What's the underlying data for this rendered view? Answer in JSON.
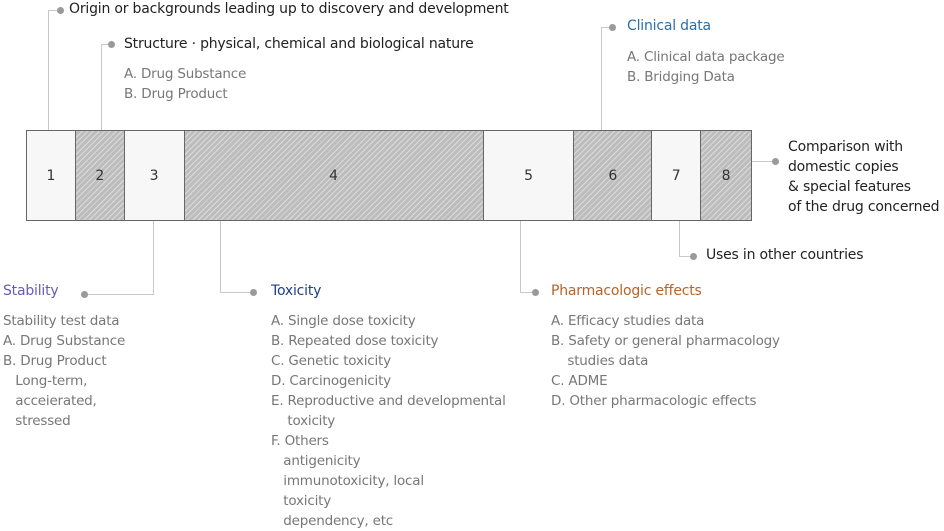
{
  "colors": {
    "stability": "#6b5bb5",
    "toxicity": "#1f3f86",
    "pharmacologic": "#b5642a",
    "clinical": "#2a6fa8"
  },
  "segments": [
    {
      "label": "1",
      "style": "light"
    },
    {
      "label": "2",
      "style": "hatched"
    },
    {
      "label": "3",
      "style": "light"
    },
    {
      "label": "4",
      "style": "hatched"
    },
    {
      "label": "5",
      "style": "light"
    },
    {
      "label": "6",
      "style": "hatched"
    },
    {
      "label": "7",
      "style": "light"
    },
    {
      "label": "8",
      "style": "hatched"
    }
  ],
  "callouts": {
    "origin": {
      "title": "Origin or backgrounds leading up to discovery and development"
    },
    "structure": {
      "title": "Structure · physical, chemical and biological nature",
      "items": "A. Drug Substance\nB. Drug Product"
    },
    "clinical": {
      "title": "Clinical data",
      "items": "A. Clinical data package\nB. Bridging Data"
    },
    "comparison": {
      "title": "Comparison with\ndomestic copies\n& special features\nof the drug concerned"
    },
    "uses": {
      "title": "Uses in other countries"
    },
    "stability": {
      "title": "Stability",
      "items": "Stability test data\nA. Drug Substance\nB. Drug Product\n   Long-term,\n   acceierated,\n   stressed"
    },
    "toxicity": {
      "title": "Toxicity",
      "items": "A. Single dose toxicity\nB. Repeated dose toxicity\nC. Genetic toxicity\nD. Carcinogenicity\nE. Reproductive and developmental\n    toxicity\nF. Others\n   antigenicity\n   immunotoxicity, local\n   toxicity\n   dependency, etc"
    },
    "pharmacologic": {
      "title": "Pharmacologic effects",
      "items": "A. Efficacy studies data\nB. Safety or general pharmacology\n    studies data\nC. ADME\nD. Other pharmacologic effects"
    }
  }
}
